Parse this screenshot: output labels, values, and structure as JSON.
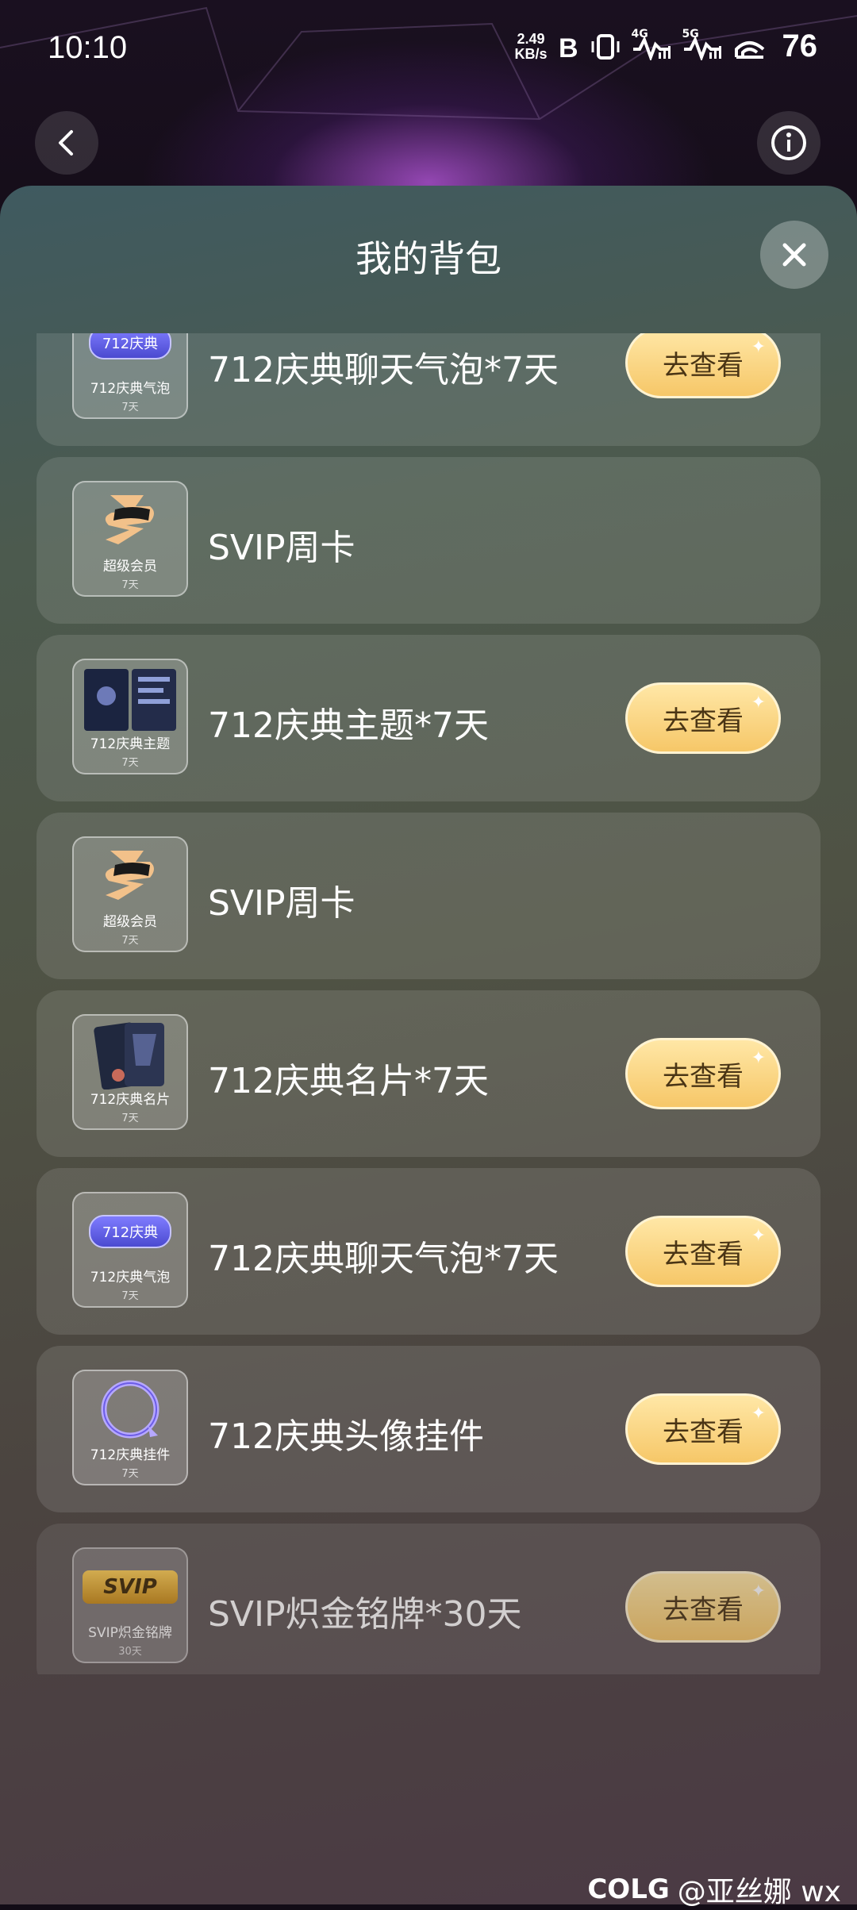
{
  "status_bar": {
    "time": "10:10",
    "net_speed_value": "2.49",
    "net_speed_unit": "KB/s",
    "icons": [
      "bluetooth-icon",
      "vibrate-icon",
      "signal-4g-icon",
      "signal-5g-icon",
      "wifi-icon"
    ],
    "network_4g": "4G",
    "network_5g": "5G",
    "battery": "76"
  },
  "header": {
    "back_icon": "chevron-left-icon",
    "info_icon": "info-icon"
  },
  "panel": {
    "title": "我的背包",
    "close_icon": "close-icon"
  },
  "items": [
    {
      "name": "712庆典聊天气泡*7天",
      "thumb_label": "712庆典气泡",
      "thumb_duration": "7天",
      "thumb_art": "chat-bubble-icon",
      "art_text": "712庆典",
      "button": "去查看"
    },
    {
      "name": "SVIP周卡",
      "thumb_label": "超级会员",
      "thumb_duration": "7天",
      "thumb_art": "svip-logo-icon",
      "button": ""
    },
    {
      "name": "712庆典主题*7天",
      "thumb_label": "712庆典主题",
      "thumb_duration": "7天",
      "thumb_art": "theme-preview-icon",
      "button": "去查看"
    },
    {
      "name": "SVIP周卡",
      "thumb_label": "超级会员",
      "thumb_duration": "7天",
      "thumb_art": "svip-logo-icon",
      "button": ""
    },
    {
      "name": "712庆典名片*7天",
      "thumb_label": "712庆典名片",
      "thumb_duration": "7天",
      "thumb_art": "card-preview-icon",
      "button": "去查看"
    },
    {
      "name": "712庆典聊天气泡*7天",
      "thumb_label": "712庆典气泡",
      "thumb_duration": "7天",
      "thumb_art": "chat-bubble-icon",
      "art_text": "712庆典",
      "button": "去查看"
    },
    {
      "name": "712庆典头像挂件",
      "thumb_label": "712庆典挂件",
      "thumb_duration": "7天",
      "thumb_art": "avatar-frame-icon",
      "button": "去查看"
    },
    {
      "name": "SVIP炽金铭牌*30天",
      "thumb_label": "SVIP炽金铭牌",
      "thumb_duration": "30天",
      "thumb_art": "svip-nameplate-icon",
      "art_text": "SVIP",
      "button": "去查看"
    }
  ],
  "watermark": {
    "logo": "COLG",
    "text": "@亚丝娜 wx"
  },
  "colors": {
    "button_gold": "#f6c768",
    "button_text": "#4a3515",
    "panel_top": "#3f5a60",
    "panel_bottom": "#4b3a44"
  }
}
